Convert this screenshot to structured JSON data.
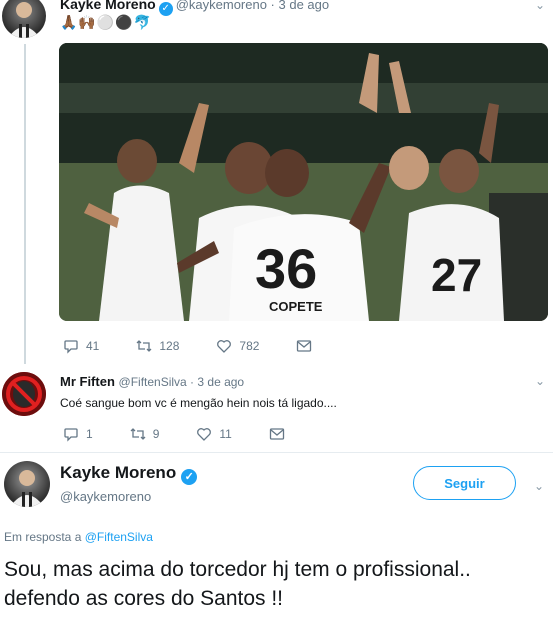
{
  "tweet1": {
    "author_name": "Kayke Moreno",
    "handle_time": "@kaykemoreno · 3 de ago",
    "emojis": "🙏🏾🙌🏾⚪⚫🐬",
    "photo_numbers": [
      "36",
      "27"
    ],
    "photo_name": "COPETE",
    "actions": {
      "replies": "41",
      "retweets": "128",
      "likes": "782"
    }
  },
  "reply": {
    "author_name": "Mr Fiften",
    "handle_time": "@FiftenSilva · 3 de ago",
    "text": "Coé sangue bom vc é mengão hein nois tá ligado....",
    "actions": {
      "replies": "1",
      "retweets": "9",
      "likes": "11"
    }
  },
  "main_tweet": {
    "author_name": "Kayke Moreno",
    "handle": "@kaykemoreno",
    "follow_label": "Seguir",
    "in_reply_prefix": "Em resposta a",
    "in_reply_handle": "@FiftenSilva",
    "text": "Sou, mas acima do torcedor hj tem o profissional.. defendo as cores do Santos !!"
  },
  "colors": {
    "accent": "#1da1f2",
    "muted": "#657786",
    "verified": "#1da1f2"
  }
}
